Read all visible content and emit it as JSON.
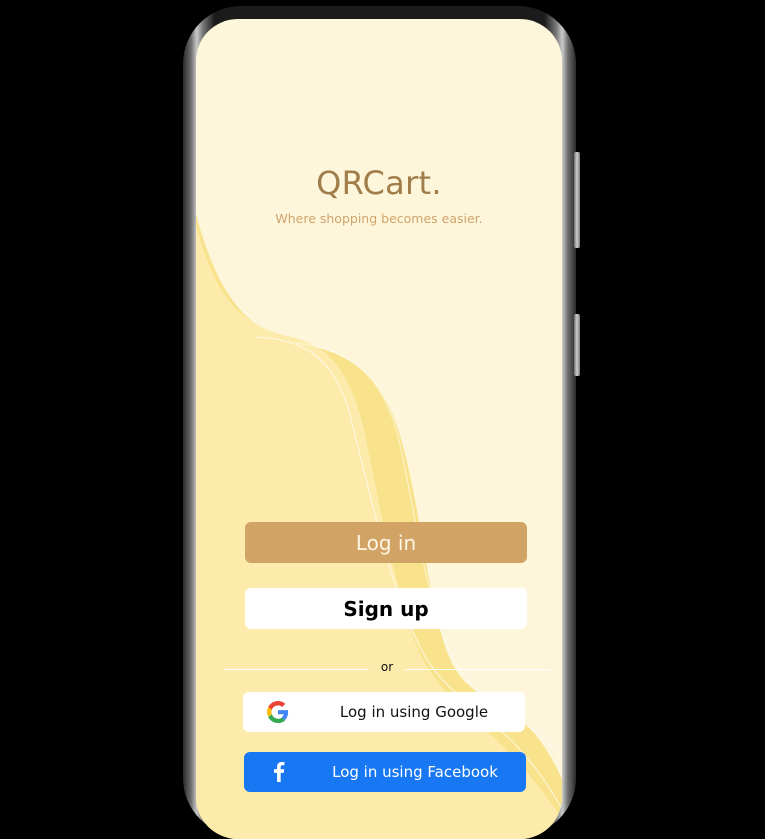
{
  "app": {
    "title": "QRCart.",
    "tagline": "Where shopping becomes easier."
  },
  "auth": {
    "login_label": "Log in",
    "signup_label": "Sign up",
    "divider_text": "or",
    "google_label": "Log in using Google",
    "facebook_label": "Log in using Facebook"
  },
  "icons": {
    "google": "google-logo-icon",
    "facebook": "facebook-logo-icon"
  },
  "colors": {
    "background": "#FDF6DB",
    "wave_light": "#FCEAA6",
    "wave_mid": "#F8E28A",
    "title": "#A17D4A",
    "tagline": "#D1A46C",
    "login_button": "#D1A466",
    "signup_button": "#FFFFFF",
    "facebook_button": "#1877F2"
  }
}
